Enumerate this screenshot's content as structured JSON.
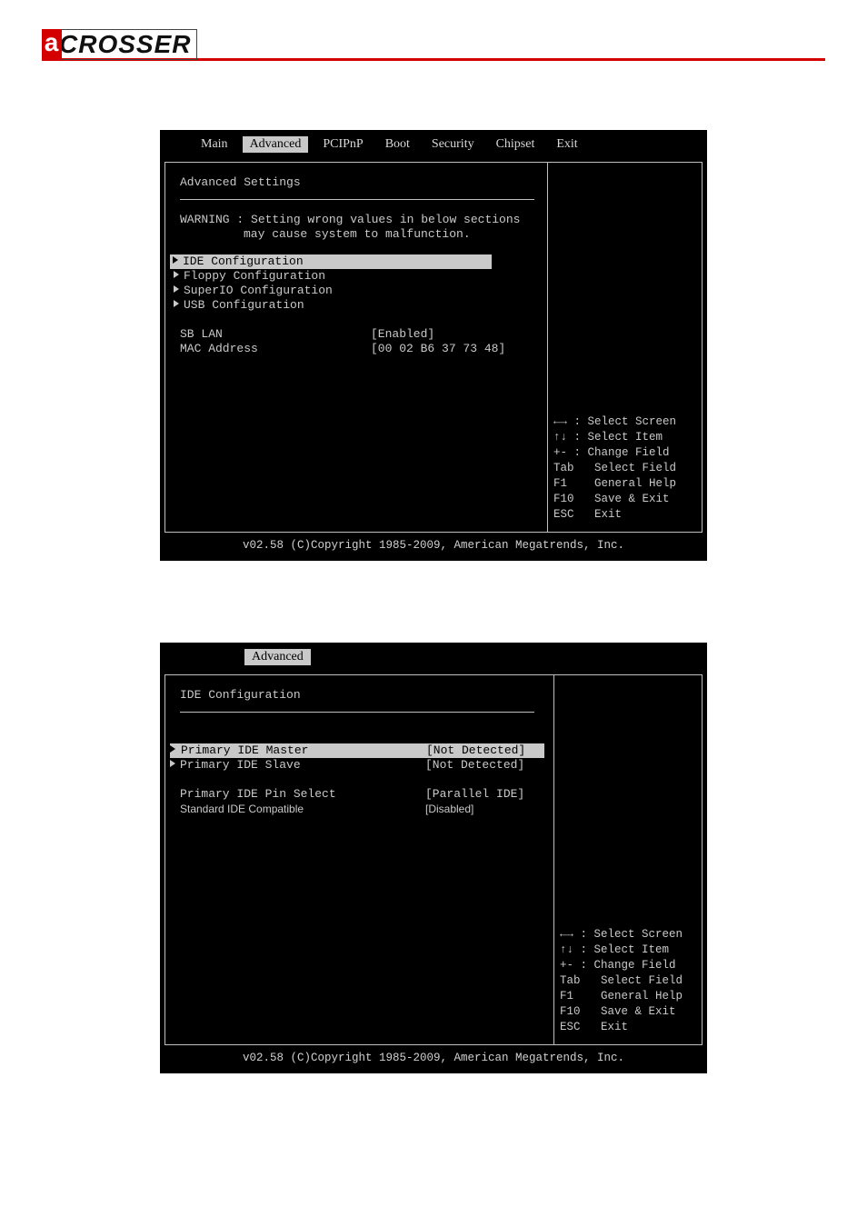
{
  "brand": {
    "accent": "a",
    "name": "CROSSER"
  },
  "screen1": {
    "tabs": [
      "Main",
      "Advanced",
      "PCIPnP",
      "Boot",
      "Security",
      "Chipset",
      "Exit"
    ],
    "tab_selected": "Advanced",
    "title": "Advanced Settings",
    "warning_l1": "WARNING : Setting wrong values in below sections",
    "warning_l2": "may cause system to malfunction.",
    "menu": [
      {
        "label": "IDE Configuration",
        "selected": true
      },
      {
        "label": "Floppy Configuration",
        "selected": false
      },
      {
        "label": "SuperIO Configuration",
        "selected": false
      },
      {
        "label": "USB Configuration",
        "selected": false
      }
    ],
    "settings": [
      {
        "key": "SB LAN",
        "value": "[Enabled]"
      },
      {
        "key": "MAC Address",
        "value": "[00 02 B6 37 73 48]"
      }
    ],
    "legend": [
      "←→ : Select Screen",
      "↑↓ : Select Item",
      "+- : Change Field",
      "Tab   Select Field",
      "F1    General Help",
      "F10   Save & Exit",
      "ESC   Exit"
    ],
    "footer": "v02.58 (C)Copyright 1985-2009, American Megatrends, Inc."
  },
  "screen2": {
    "tab_selected": "Advanced",
    "title": "IDE Configuration",
    "rows": [
      {
        "arrow": true,
        "selected": true,
        "key": "Primary IDE Master",
        "value": "[Not Detected]",
        "sans": false
      },
      {
        "arrow": true,
        "selected": false,
        "key": "Primary IDE Slave",
        "value": "[Not Detected]",
        "sans": false
      },
      {
        "spacer": true
      },
      {
        "arrow": false,
        "selected": false,
        "key": "Primary IDE Pin Select",
        "value": "[Parallel IDE]",
        "sans": false
      },
      {
        "arrow": false,
        "selected": false,
        "key": "Standard IDE Compatible",
        "value": "[Disabled]",
        "sans": true
      }
    ],
    "legend": [
      "←→ : Select Screen",
      "↑↓ : Select Item",
      "+- : Change Field",
      "Tab   Select Field",
      "F1    General Help",
      "F10   Save & Exit",
      "ESC   Exit"
    ],
    "footer": "v02.58 (C)Copyright 1985-2009, American Megatrends, Inc."
  }
}
